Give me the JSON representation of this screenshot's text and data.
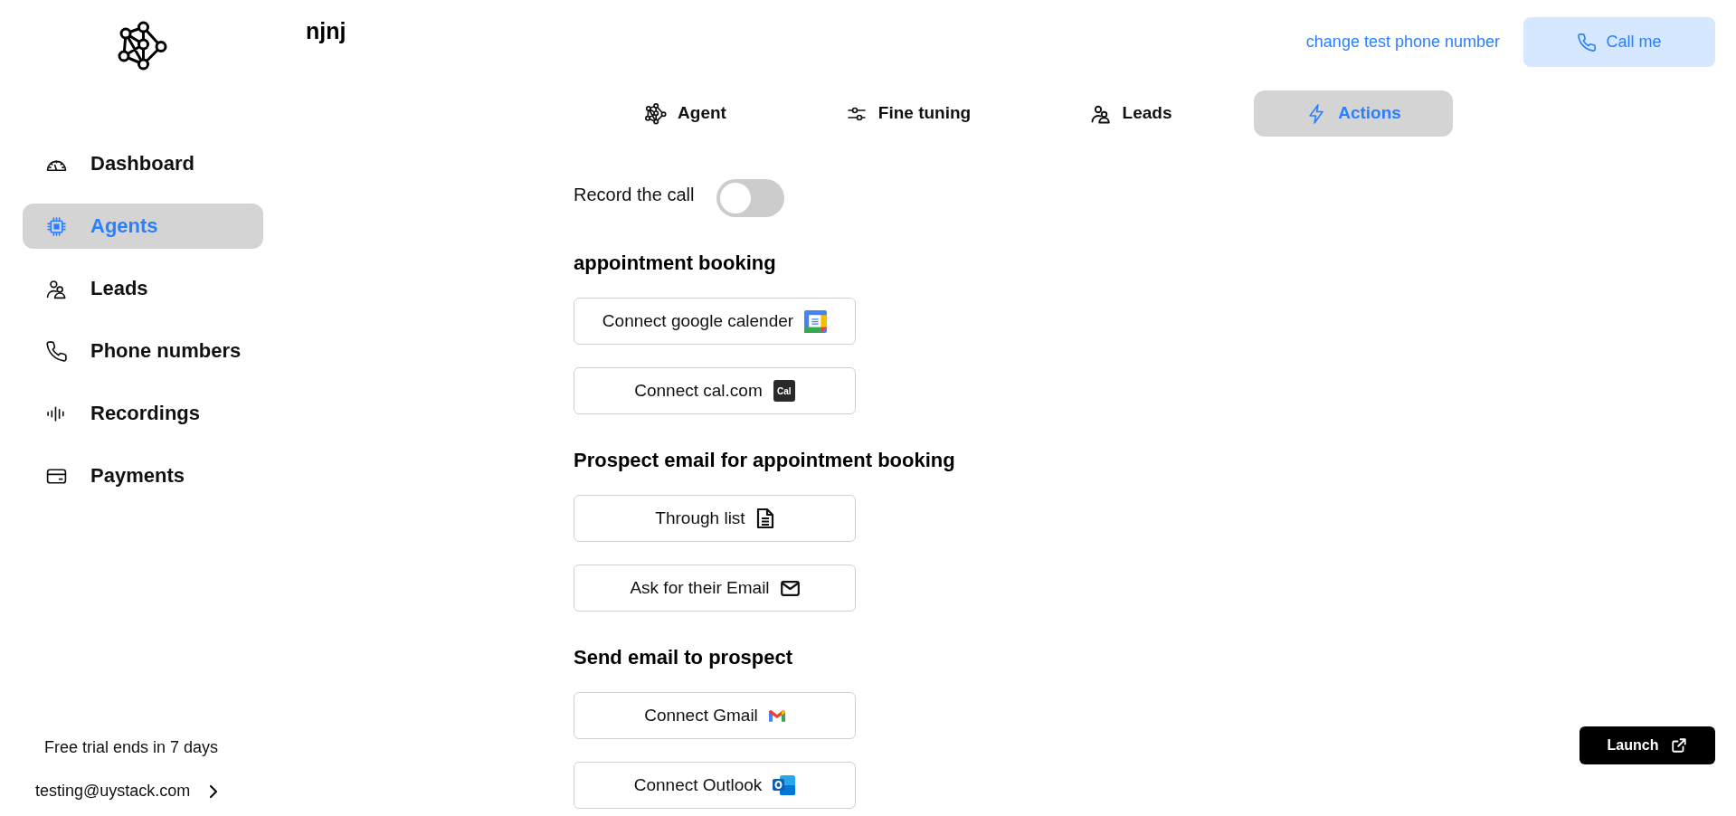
{
  "sidebar": {
    "items": [
      {
        "label": "Dashboard",
        "selected": false
      },
      {
        "label": "Agents",
        "selected": true
      },
      {
        "label": "Leads",
        "selected": false
      },
      {
        "label": "Phone numbers",
        "selected": false
      },
      {
        "label": "Recordings",
        "selected": false
      },
      {
        "label": "Payments",
        "selected": false
      }
    ],
    "trial_notice": "Free trial ends in 7 days",
    "account_email": "testing@uystack.com"
  },
  "header": {
    "title": "njnj",
    "link": "change test phone number",
    "call_button": "Call me"
  },
  "tabs": [
    {
      "label": "Agent",
      "selected": false
    },
    {
      "label": "Fine tuning",
      "selected": false
    },
    {
      "label": "Leads",
      "selected": false
    },
    {
      "label": "Actions",
      "selected": true
    }
  ],
  "record_call": {
    "label": "Record the call",
    "on": false
  },
  "sections": [
    {
      "heading": "appointment booking",
      "buttons": [
        {
          "label": "Connect google calender"
        },
        {
          "label": "Connect cal.com",
          "logo": "Cal"
        }
      ]
    },
    {
      "heading": "Prospect email for appointment booking",
      "buttons": [
        {
          "label": "Through list"
        },
        {
          "label": "Ask for their Email"
        }
      ]
    },
    {
      "heading": "Send email to prospect",
      "buttons": [
        {
          "label": "Connect Gmail"
        },
        {
          "label": "Connect Outlook"
        }
      ]
    }
  ],
  "launch_button": "Launch"
}
